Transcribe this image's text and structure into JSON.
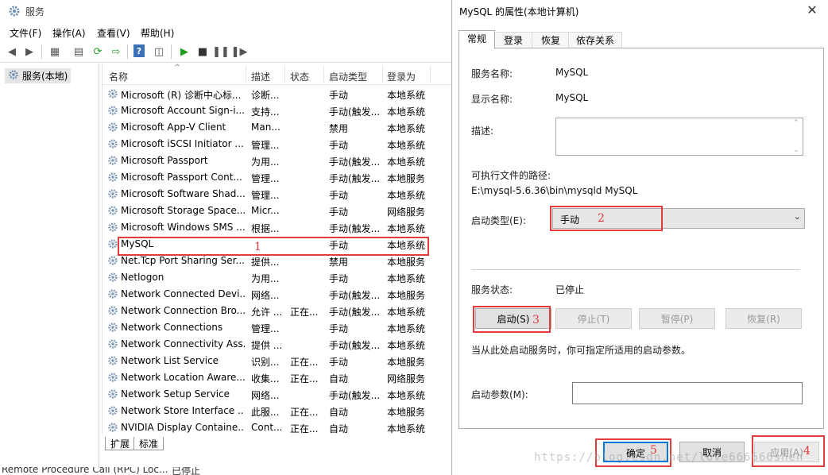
{
  "services_window": {
    "title": "服务",
    "menu": [
      "文件(F)",
      "操作(A)",
      "查看(V)",
      "帮助(H)"
    ],
    "tree_node": "服务(本地)",
    "columns": [
      "名称",
      "描述",
      "状态",
      "启动类型",
      "登录为"
    ],
    "rows": [
      [
        "Microsoft (R) 诊断中心标...",
        "诊断...",
        "",
        "手动",
        "本地系统"
      ],
      [
        "Microsoft Account Sign-i...",
        "支持...",
        "",
        "手动(触发...",
        "本地系统"
      ],
      [
        "Microsoft App-V Client",
        "Man...",
        "",
        "禁用",
        "本地系统"
      ],
      [
        "Microsoft iSCSI Initiator ...",
        "管理...",
        "",
        "手动",
        "本地系统"
      ],
      [
        "Microsoft Passport",
        "为用...",
        "",
        "手动(触发...",
        "本地系统"
      ],
      [
        "Microsoft Passport Cont...",
        "管理...",
        "",
        "手动(触发...",
        "本地服务"
      ],
      [
        "Microsoft Software Shad...",
        "管理...",
        "",
        "手动",
        "本地系统"
      ],
      [
        "Microsoft Storage Space...",
        "Micr...",
        "",
        "手动",
        "网络服务"
      ],
      [
        "Microsoft Windows SMS ...",
        "根据...",
        "",
        "手动(触发...",
        "本地系统"
      ],
      [
        "MySQL",
        "",
        "",
        "手动",
        "本地系统"
      ],
      [
        "Net.Tcp Port Sharing Ser...",
        "提供...",
        "",
        "禁用",
        "本地服务"
      ],
      [
        "Netlogon",
        "为用...",
        "",
        "手动",
        "本地系统"
      ],
      [
        "Network Connected Devi...",
        "网络...",
        "",
        "手动(触发...",
        "本地服务"
      ],
      [
        "Network Connection Bro...",
        "允许 ...",
        "正在...",
        "手动(触发...",
        "本地系统"
      ],
      [
        "Network Connections",
        "管理...",
        "",
        "手动",
        "本地系统"
      ],
      [
        "Network Connectivity Ass...",
        "提供 ...",
        "",
        "手动(触发...",
        "本地系统"
      ],
      [
        "Network List Service",
        "识别...",
        "正在...",
        "手动",
        "本地服务"
      ],
      [
        "Network Location Aware...",
        "收集...",
        "正在...",
        "自动",
        "网络服务"
      ],
      [
        "Network Setup Service",
        "网络...",
        "",
        "手动(触发...",
        "本地系统"
      ],
      [
        "Network Store Interface ...",
        "此服...",
        "正在...",
        "自动",
        "本地服务"
      ],
      [
        "NVIDIA Display Containe...",
        "Cont...",
        "正在...",
        "自动",
        "本地系统"
      ]
    ],
    "bottom_tabs": [
      "扩展",
      "标准"
    ],
    "status_partial": [
      "Remote Procedure Call (RPC) Loc...",
      "已停止"
    ]
  },
  "dialog": {
    "title": "MySQL 的属性(本地计算机)",
    "tabs": [
      "常规",
      "登录",
      "恢复",
      "依存关系"
    ],
    "service_name_label": "服务名称:",
    "service_name": "MySQL",
    "display_name_label": "显示名称:",
    "display_name": "MySQL",
    "description_label": "描述:",
    "exe_path_label": "可执行文件的路径:",
    "exe_path": "E:\\mysql-5.6.36\\bin\\mysqld MySQL",
    "startup_type_label": "启动类型(E):",
    "startup_type": "手动",
    "status_label": "服务状态:",
    "status": "已停止",
    "buttons": {
      "start": "启动(S)",
      "stop": "停止(T)",
      "pause": "暂停(P)",
      "resume": "恢复(R)"
    },
    "hint": "当从此处启动服务时，你可指定所适用的启动参数。",
    "params_label": "启动参数(M):",
    "ok": "确定",
    "cancel": "取消",
    "apply": "应用(A)"
  },
  "annotations": {
    "marks": [
      "1",
      "2",
      "3",
      "4",
      "5"
    ],
    "color": "#e23b3b"
  },
  "watermark": "https://blog.csdn.net/love666666shen"
}
